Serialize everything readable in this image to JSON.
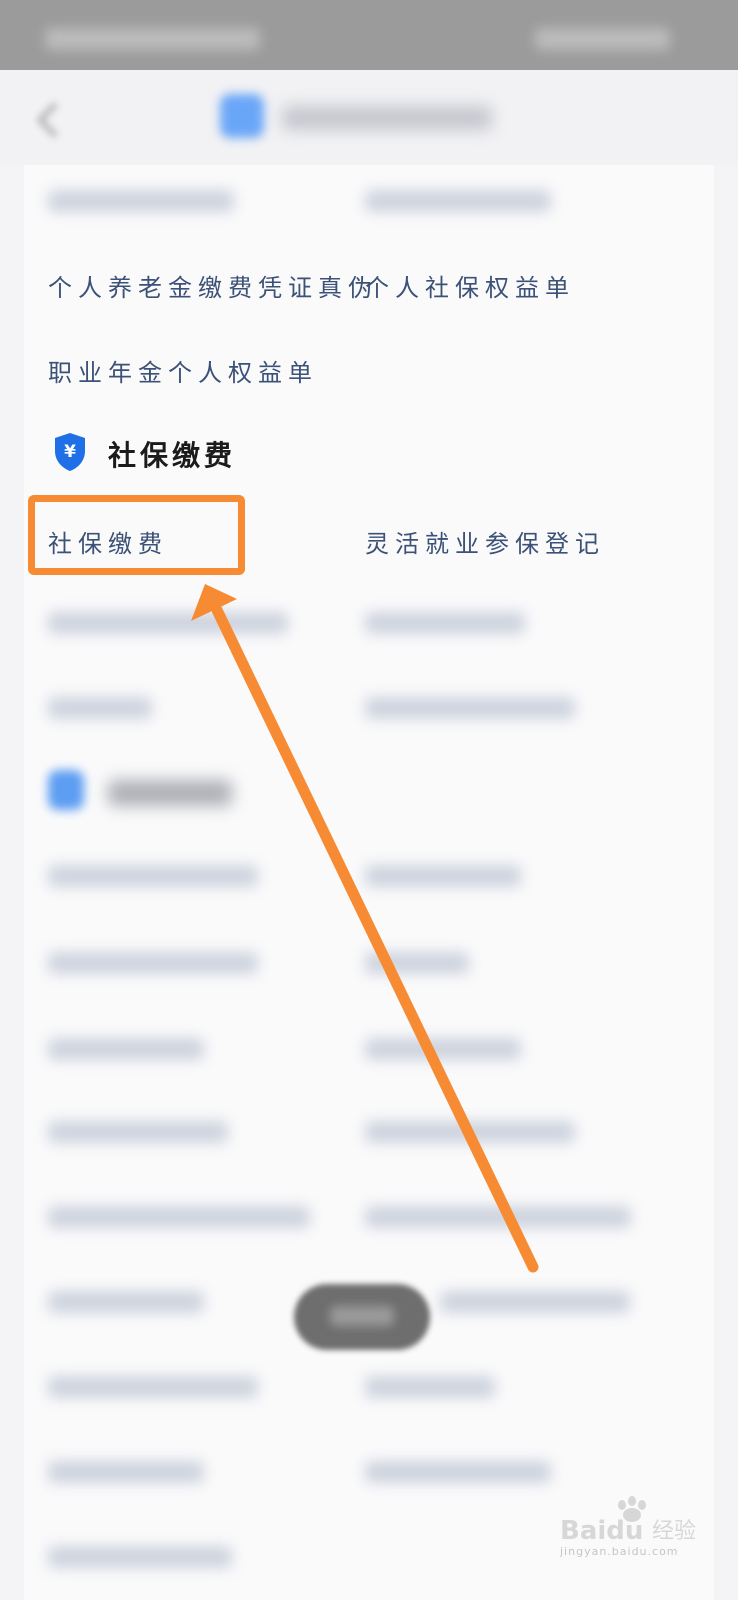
{
  "menu": {
    "row_pension_certificate": "个人养老金缴费凭证真伪",
    "row_social_rights": "个人社保权益单",
    "row_annuity_rights": "职业年金个人权益单"
  },
  "section": {
    "title": "社保缴费",
    "icon": "yuan-shield-icon",
    "icon_glyph": "¥",
    "items": {
      "payment": "社保缴费",
      "flexible": "灵活就业参保登记"
    }
  },
  "watermark": {
    "brand": "Baidu",
    "cn": "经验",
    "url": "jingyan.baidu.com"
  },
  "colors": {
    "highlight": "#f78b33",
    "link_text": "#3c5177",
    "icon_blue": "#1f6fe6"
  }
}
